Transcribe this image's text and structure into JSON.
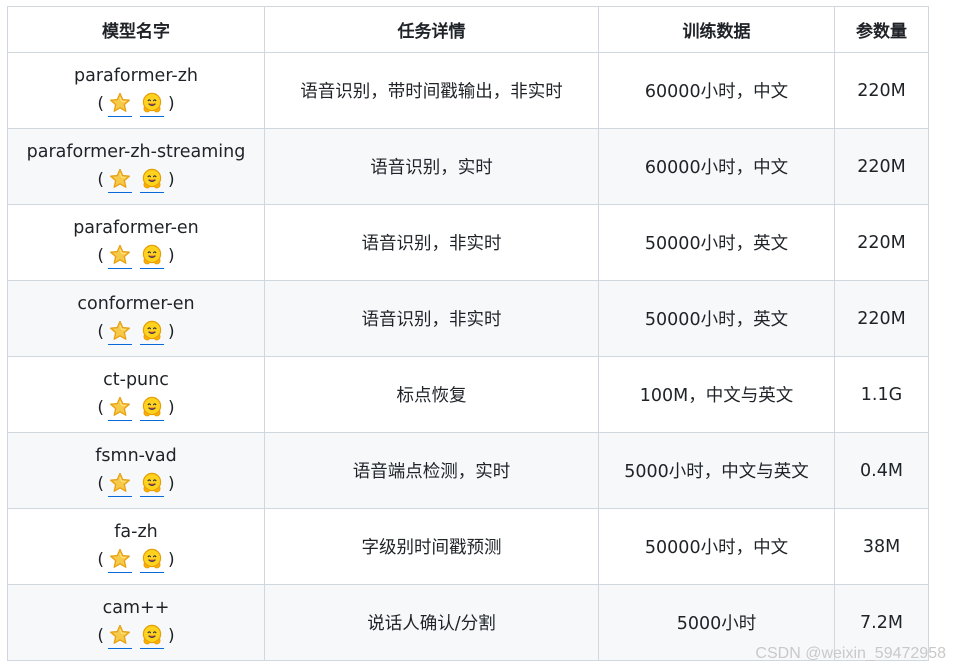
{
  "table": {
    "headers": [
      "模型名字",
      "任务详情",
      "训练数据",
      "参数量"
    ],
    "link_open": "(",
    "link_close": ")",
    "rows": [
      {
        "name": "paraformer-zh",
        "task": "语音识别，带时间戳输出，非实时",
        "data": "60000小时，中文",
        "params": "220M"
      },
      {
        "name": "paraformer-zh-streaming",
        "task": "语音识别，实时",
        "data": "60000小时，中文",
        "params": "220M"
      },
      {
        "name": "paraformer-en",
        "task": "语音识别，非实时",
        "data": "50000小时，英文",
        "params": "220M"
      },
      {
        "name": "conformer-en",
        "task": "语音识别，非实时",
        "data": "50000小时，英文",
        "params": "220M"
      },
      {
        "name": "ct-punc",
        "task": "标点恢复",
        "data": "100M，中文与英文",
        "params": "1.1G"
      },
      {
        "name": "fsmn-vad",
        "task": "语音端点检测，实时",
        "data": "5000小时，中文与英文",
        "params": "0.4M"
      },
      {
        "name": "fa-zh",
        "task": "字级别时间戳预测",
        "data": "50000小时，中文",
        "params": "38M"
      },
      {
        "name": "cam++",
        "task": "说话人确认/分割",
        "data": "5000小时",
        "params": "7.2M"
      }
    ]
  },
  "icons": {
    "star": "star-icon",
    "hugging_face": "hugging-face-icon"
  },
  "colors": {
    "border": "#d0d7de",
    "stripe": "#f6f8fa",
    "star_fill": "#f7c948",
    "star_stroke": "#e8a317",
    "face_fill": "#ffd21e",
    "face_stroke": "#e5a10a",
    "link": "#0969da"
  },
  "watermark": "CSDN @weixin_59472958"
}
